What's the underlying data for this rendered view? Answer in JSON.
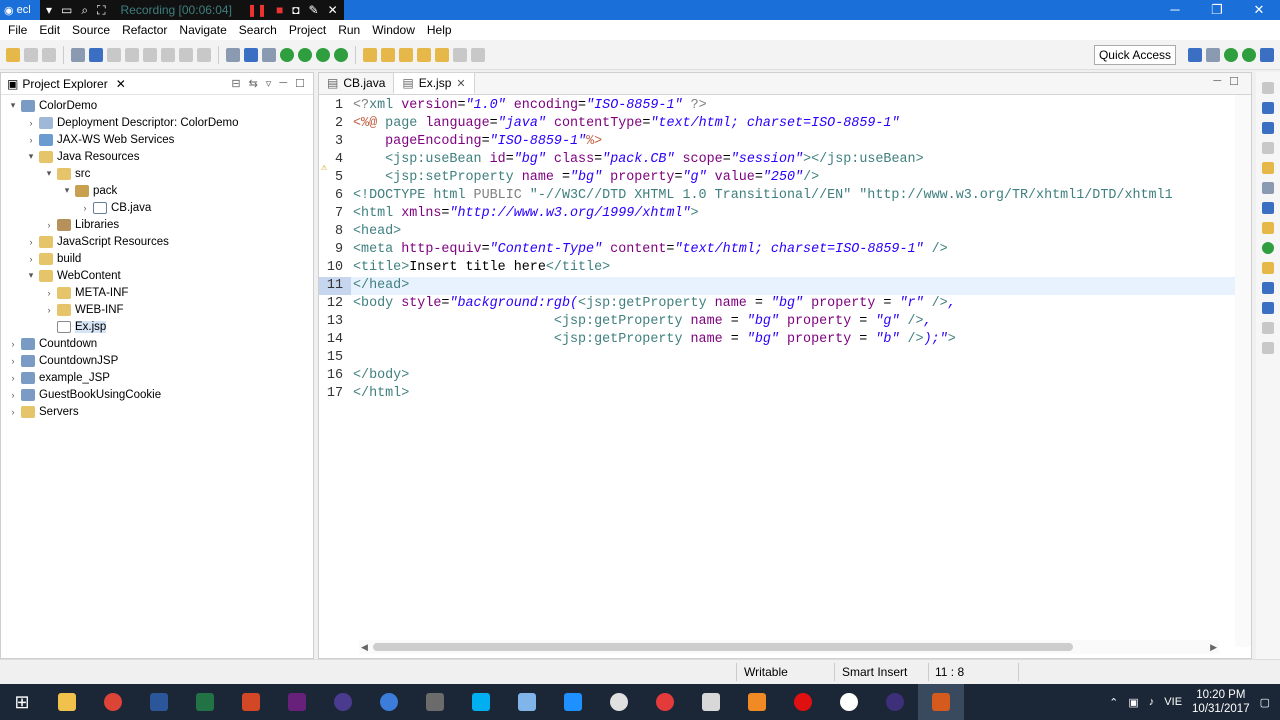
{
  "titlebar": {
    "app": "ecl",
    "recording": "Recording [00:06:04]"
  },
  "menu": [
    "File",
    "Edit",
    "Source",
    "Refactor",
    "Navigate",
    "Search",
    "Project",
    "Run",
    "Window",
    "Help"
  ],
  "toolbar": {
    "quick_access": "Quick Access"
  },
  "explorer": {
    "title": "Project Explorer",
    "items": [
      {
        "label": "ColorDemo",
        "indent": 0,
        "arrow": "▾",
        "icon": "proj"
      },
      {
        "label": "Deployment Descriptor: ColorDemo",
        "indent": 1,
        "arrow": "›",
        "icon": "dd"
      },
      {
        "label": "JAX-WS Web Services",
        "indent": 1,
        "arrow": "›",
        "icon": "ws"
      },
      {
        "label": "Java Resources",
        "indent": 1,
        "arrow": "▾",
        "icon": "fold"
      },
      {
        "label": "src",
        "indent": 2,
        "arrow": "▾",
        "icon": "fold"
      },
      {
        "label": "pack",
        "indent": 3,
        "arrow": "▾",
        "icon": "pkg"
      },
      {
        "label": "CB.java",
        "indent": 4,
        "arrow": "›",
        "icon": "java"
      },
      {
        "label": "Libraries",
        "indent": 2,
        "arrow": "›",
        "icon": "lib"
      },
      {
        "label": "JavaScript Resources",
        "indent": 1,
        "arrow": "›",
        "icon": "fold"
      },
      {
        "label": "build",
        "indent": 1,
        "arrow": "›",
        "icon": "fold"
      },
      {
        "label": "WebContent",
        "indent": 1,
        "arrow": "▾",
        "icon": "fold"
      },
      {
        "label": "META-INF",
        "indent": 2,
        "arrow": "›",
        "icon": "fold"
      },
      {
        "label": "WEB-INF",
        "indent": 2,
        "arrow": "›",
        "icon": "fold"
      },
      {
        "label": "Ex.jsp",
        "indent": 2,
        "arrow": "",
        "icon": "jsp",
        "selected": true
      },
      {
        "label": "Countdown",
        "indent": 0,
        "arrow": "›",
        "icon": "proj"
      },
      {
        "label": "CountdownJSP",
        "indent": 0,
        "arrow": "›",
        "icon": "proj"
      },
      {
        "label": "example_JSP",
        "indent": 0,
        "arrow": "›",
        "icon": "proj"
      },
      {
        "label": "GuestBookUsingCookie",
        "indent": 0,
        "arrow": "›",
        "icon": "proj"
      },
      {
        "label": "Servers",
        "indent": 0,
        "arrow": "›",
        "icon": "fold"
      }
    ]
  },
  "editor": {
    "tabs": [
      {
        "label": "CB.java",
        "active": false
      },
      {
        "label": "Ex.jsp",
        "active": true
      }
    ],
    "lines": [
      {
        "n": "1",
        "s": [
          [
            "d",
            "<?"
          ],
          [
            "t",
            "xml "
          ],
          [
            "a",
            "version"
          ],
          [
            "tx",
            "="
          ],
          [
            "v",
            "\"1.0\""
          ],
          [
            "a",
            " encoding"
          ],
          [
            "tx",
            "="
          ],
          [
            "v",
            "\"ISO-8859-1\""
          ],
          [
            "d",
            " ?>"
          ]
        ]
      },
      {
        "n": "2",
        "s": [
          [
            "dir",
            "<%@ "
          ],
          [
            "t",
            "page "
          ],
          [
            "a",
            "language"
          ],
          [
            "tx",
            "="
          ],
          [
            "v",
            "\"java\""
          ],
          [
            "a",
            " contentType"
          ],
          [
            "tx",
            "="
          ],
          [
            "v",
            "\"text/html; charset=ISO-8859-1\""
          ]
        ]
      },
      {
        "n": "3",
        "s": [
          [
            "a",
            "    pageEncoding"
          ],
          [
            "tx",
            "="
          ],
          [
            "v",
            "\"ISO-8859-1\""
          ],
          [
            "dir",
            "%>"
          ]
        ]
      },
      {
        "n": "4",
        "s": [
          [
            "t",
            "    <jsp:useBean "
          ],
          [
            "a",
            "id"
          ],
          [
            "tx",
            "="
          ],
          [
            "v",
            "\"bg\""
          ],
          [
            "a",
            " class"
          ],
          [
            "tx",
            "="
          ],
          [
            "v",
            "\"pack.CB\""
          ],
          [
            "a",
            " scope"
          ],
          [
            "tx",
            "="
          ],
          [
            "v",
            "\"session\""
          ],
          [
            "t",
            "></jsp:useBean>"
          ]
        ]
      },
      {
        "n": "5",
        "s": [
          [
            "t",
            "    <jsp:setProperty "
          ],
          [
            "a",
            "name "
          ],
          [
            "tx",
            "="
          ],
          [
            "v",
            "\"bg\""
          ],
          [
            "a",
            " property"
          ],
          [
            "tx",
            "="
          ],
          [
            "v",
            "\"g\""
          ],
          [
            "a",
            " value"
          ],
          [
            "tx",
            "="
          ],
          [
            "v",
            "\"250\""
          ],
          [
            "t",
            "/>"
          ]
        ]
      },
      {
        "n": "6",
        "s": [
          [
            "t",
            "<!DOCTYPE "
          ],
          [
            "t",
            "html "
          ],
          [
            "d",
            "PUBLIC "
          ],
          [
            "t",
            "\"-//W3C//DTD XHTML 1.0 Transitional//EN\" "
          ],
          [
            "t",
            "\"http://www.w3.org/TR/xhtml1/DTD/xhtml1"
          ]
        ]
      },
      {
        "n": "7",
        "s": [
          [
            "t",
            "<html "
          ],
          [
            "a",
            "xmlns"
          ],
          [
            "tx",
            "="
          ],
          [
            "v",
            "\"http://www.w3.org/1999/xhtml\""
          ],
          [
            "t",
            ">"
          ]
        ]
      },
      {
        "n": "8",
        "s": [
          [
            "t",
            "<head>"
          ]
        ]
      },
      {
        "n": "9",
        "s": [
          [
            "t",
            "<meta "
          ],
          [
            "a",
            "http-equiv"
          ],
          [
            "tx",
            "="
          ],
          [
            "v",
            "\"Content-Type\""
          ],
          [
            "a",
            " content"
          ],
          [
            "tx",
            "="
          ],
          [
            "v",
            "\"text/html; charset=ISO-8859-1\""
          ],
          [
            "t",
            " />"
          ]
        ]
      },
      {
        "n": "10",
        "s": [
          [
            "t",
            "<title>"
          ],
          [
            "tx",
            "Insert title here"
          ],
          [
            "t",
            "</title>"
          ]
        ]
      },
      {
        "n": "11",
        "s": [
          [
            "t",
            "</head>"
          ]
        ],
        "current": true
      },
      {
        "n": "12",
        "s": [
          [
            "t",
            "<body "
          ],
          [
            "a",
            "style"
          ],
          [
            "tx",
            "="
          ],
          [
            "v",
            "\"background:rgb("
          ],
          [
            "t",
            "<jsp:getProperty "
          ],
          [
            "a",
            "name "
          ],
          [
            "tx",
            "= "
          ],
          [
            "v",
            "\"bg\""
          ],
          [
            "a",
            " property "
          ],
          [
            "tx",
            "= "
          ],
          [
            "v",
            "\"r\""
          ],
          [
            "t",
            " />"
          ],
          [
            "v",
            ","
          ]
        ]
      },
      {
        "n": "13",
        "s": [
          [
            "tx",
            "                         "
          ],
          [
            "t",
            "<jsp:getProperty "
          ],
          [
            "a",
            "name "
          ],
          [
            "tx",
            "= "
          ],
          [
            "v",
            "\"bg\""
          ],
          [
            "a",
            " property "
          ],
          [
            "tx",
            "= "
          ],
          [
            "v",
            "\"g\""
          ],
          [
            "t",
            " />"
          ],
          [
            "v",
            ","
          ]
        ]
      },
      {
        "n": "14",
        "s": [
          [
            "tx",
            "                         "
          ],
          [
            "t",
            "<jsp:getProperty "
          ],
          [
            "a",
            "name "
          ],
          [
            "tx",
            "= "
          ],
          [
            "v",
            "\"bg\""
          ],
          [
            "a",
            " property "
          ],
          [
            "tx",
            "= "
          ],
          [
            "v",
            "\"b\""
          ],
          [
            "t",
            " />"
          ],
          [
            "v",
            ");\""
          ],
          [
            "t",
            ">"
          ]
        ]
      },
      {
        "n": "15",
        "s": [
          [
            "tx",
            ""
          ]
        ]
      },
      {
        "n": "16",
        "s": [
          [
            "t",
            "</body>"
          ]
        ]
      },
      {
        "n": "17",
        "s": [
          [
            "t",
            "</html>"
          ]
        ]
      }
    ]
  },
  "status": {
    "mode": "Writable",
    "insert": "Smart Insert",
    "position": "11 : 8"
  },
  "taskbar": {
    "time": "10:20 PM",
    "date": "10/31/2017",
    "lang": "VIE"
  },
  "colors": {
    "titlebar": "#1a6fd8",
    "taskbar": "#1b2636",
    "tag": "#3f7f7f",
    "attr": "#7f007f",
    "value": "#2a00ff"
  }
}
